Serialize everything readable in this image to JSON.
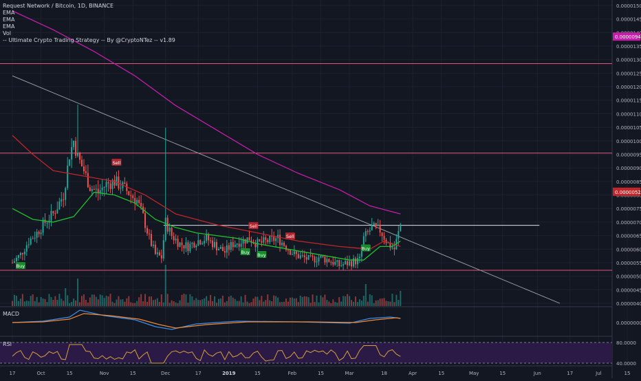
{
  "legend": {
    "title": "Request Network / Bitcoin, 1D, BINANCE",
    "ema1": "EMA",
    "ema2": "EMA",
    "ema3": "EMA",
    "vol": "Vol",
    "strategy": "-- Ultimate Crypto Trading Strategy -- By @CryptoNTez -- v1.89"
  },
  "panes": {
    "macd_label": "MACD",
    "rsi_label": "RSI"
  },
  "colors": {
    "background": "#131722",
    "up": "#26a69a",
    "down": "#ef5350",
    "ema_fast": "#20c030",
    "ema_mid": "#c0262a",
    "ema_slow": "#c41ea8",
    "hline": "#e2557b",
    "trendline": "#9598a1",
    "rsi_band": "#2a1a45",
    "rsi_line": "#d6a23a",
    "macd_line": "#3d8eea",
    "signal_line": "#f08a35"
  },
  "chart_data": {
    "type": "candlestick",
    "price_axis_ticks": [
      "0.00001500",
      "0.00001450",
      "0.00001400",
      "0.00001350",
      "0.00001300",
      "0.00001250",
      "0.00001200",
      "0.00001150",
      "0.00001100",
      "0.00001050",
      "0.00001000",
      "0.00000950",
      "0.00000900",
      "0.00000850",
      "0.00000800",
      "0.00000750",
      "0.00000700",
      "0.00000650",
      "0.00000600",
      "0.00000550",
      "0.00000500",
      "0.00000450",
      "0.00000400"
    ],
    "price_badges": [
      {
        "label": "0.00000949",
        "value": 1.385e-05,
        "color": "#c41ea8"
      },
      {
        "label": "0.00000522",
        "value": 8.12e-06,
        "color": "#c0262a"
      }
    ],
    "y_range": [
      3.9e-06,
      1.52e-05
    ],
    "time_axis": [
      {
        "label": "17",
        "day": 0
      },
      {
        "label": "Oct",
        "day": 14
      },
      {
        "label": "15",
        "day": 28
      },
      {
        "label": "Nov",
        "day": 45
      },
      {
        "label": "15",
        "day": 59
      },
      {
        "label": "Dec",
        "day": 75
      },
      {
        "label": "17",
        "day": 91
      },
      {
        "label": "2019",
        "day": 106
      },
      {
        "label": "15",
        "day": 120
      },
      {
        "label": "Feb",
        "day": 137
      },
      {
        "label": "15",
        "day": 151
      },
      {
        "label": "Mar",
        "day": 165
      },
      {
        "label": "18",
        "day": 182
      },
      {
        "label": "Apr",
        "day": 196
      },
      {
        "label": "15",
        "day": 210
      },
      {
        "label": "May",
        "day": 226
      },
      {
        "label": "15",
        "day": 240
      },
      {
        "label": "Jun",
        "day": 257
      },
      {
        "label": "17",
        "day": 273
      },
      {
        "label": "Jul",
        "day": 287
      },
      {
        "label": "15",
        "day": 301
      }
    ],
    "signals": [
      {
        "label": "Buy",
        "day": 4,
        "kind": "buy"
      },
      {
        "label": "Sell",
        "day": 51,
        "kind": "sell"
      },
      {
        "label": "Sell",
        "day": 118,
        "kind": "sell"
      },
      {
        "label": "Buy",
        "day": 114,
        "kind": "buy"
      },
      {
        "label": "Buy",
        "day": 122,
        "kind": "buy"
      },
      {
        "label": "Sell",
        "day": 136,
        "kind": "sell"
      },
      {
        "label": "Buy",
        "day": 173,
        "kind": "buy"
      }
    ],
    "horizontal_levels": [
      1.285e-05,
      9.55e-06,
      5.22e-06
    ],
    "resistance": {
      "from_day": 74,
      "to_day": 258,
      "value": 6.88e-06
    },
    "trendline": {
      "from": [
        0,
        1.24e-05
      ],
      "to": [
        268,
        4e-06
      ]
    },
    "ema_slow_points": [
      [
        0,
        1.48e-05
      ],
      [
        20,
        1.41e-05
      ],
      [
        40,
        1.33e-05
      ],
      [
        60,
        1.24e-05
      ],
      [
        80,
        1.13e-05
      ],
      [
        100,
        1.04e-05
      ],
      [
        120,
        9.5e-06
      ],
      [
        140,
        8.8e-06
      ],
      [
        160,
        8.2e-06
      ],
      [
        175,
        7.6e-06
      ],
      [
        190,
        7.3e-06
      ]
    ],
    "ema_mid_points": [
      [
        0,
        1.02e-05
      ],
      [
        10,
        9.5e-06
      ],
      [
        20,
        8.9e-06
      ],
      [
        35,
        8.7e-06
      ],
      [
        50,
        8.5e-06
      ],
      [
        65,
        8e-06
      ],
      [
        80,
        7.3e-06
      ],
      [
        100,
        6.9e-06
      ],
      [
        120,
        6.6e-06
      ],
      [
        140,
        6.3e-06
      ],
      [
        160,
        6.1e-06
      ],
      [
        175,
        6e-06
      ],
      [
        182,
        6.3e-06
      ],
      [
        190,
        6.1e-06
      ]
    ],
    "ema_fast_points": [
      [
        0,
        7.5e-06
      ],
      [
        10,
        7.1e-06
      ],
      [
        20,
        7e-06
      ],
      [
        30,
        7.2e-06
      ],
      [
        40,
        8.1e-06
      ],
      [
        50,
        8e-06
      ],
      [
        60,
        7.7e-06
      ],
      [
        70,
        7.1e-06
      ],
      [
        80,
        6.8e-06
      ],
      [
        90,
        6.6e-06
      ],
      [
        100,
        6.5e-06
      ],
      [
        110,
        6.4e-06
      ],
      [
        120,
        6.2e-06
      ],
      [
        135,
        6e-06
      ],
      [
        150,
        5.8e-06
      ],
      [
        165,
        5.6e-06
      ],
      [
        172,
        5.6e-06
      ],
      [
        180,
        6.1e-06
      ],
      [
        186,
        6.1e-06
      ],
      [
        190,
        6.3e-06
      ]
    ],
    "price_path": [
      [
        0,
        5.5e-06
      ],
      [
        4,
        5.8e-06
      ],
      [
        8,
        6.3e-06
      ],
      [
        12,
        6.6e-06
      ],
      [
        16,
        7e-06
      ],
      [
        20,
        7.3e-06
      ],
      [
        25,
        8e-06
      ],
      [
        28,
        9.5e-06
      ],
      [
        30,
        1e-05
      ],
      [
        32,
        9.4e-06
      ],
      [
        35,
        8.9e-06
      ],
      [
        38,
        8.3e-06
      ],
      [
        42,
        8.1e-06
      ],
      [
        46,
        8.4e-06
      ],
      [
        50,
        8.5e-06
      ],
      [
        54,
        8.3e-06
      ],
      [
        58,
        8e-06
      ],
      [
        61,
        7.8e-06
      ],
      [
        64,
        7.2e-06
      ],
      [
        67,
        6.4e-06
      ],
      [
        70,
        5.8e-06
      ],
      [
        73,
        5.7e-06
      ],
      [
        75,
        7e-06
      ],
      [
        78,
        6.5e-06
      ],
      [
        82,
        6.2e-06
      ],
      [
        86,
        6.1e-06
      ],
      [
        90,
        6.3e-06
      ],
      [
        95,
        6.4e-06
      ],
      [
        100,
        6.1e-06
      ],
      [
        104,
        5.9e-06
      ],
      [
        108,
        6.2e-06
      ],
      [
        112,
        6.3e-06
      ],
      [
        116,
        6.4e-06
      ],
      [
        120,
        6.2e-06
      ],
      [
        125,
        6.3e-06
      ],
      [
        130,
        6.4e-06
      ],
      [
        134,
        6.1e-06
      ],
      [
        138,
        5.8e-06
      ],
      [
        142,
        5.7e-06
      ],
      [
        146,
        5.6e-06
      ],
      [
        150,
        5.7e-06
      ],
      [
        155,
        5.6e-06
      ],
      [
        160,
        5.4e-06
      ],
      [
        165,
        5.5e-06
      ],
      [
        170,
        5.6e-06
      ],
      [
        172,
        6.4e-06
      ],
      [
        176,
        6.8e-06
      ],
      [
        180,
        6.7e-06
      ],
      [
        184,
        6.2e-06
      ],
      [
        187,
        6e-06
      ],
      [
        190,
        6.9e-06
      ]
    ],
    "rsi_ticks": [
      "80.0000",
      "40.0000"
    ],
    "macd_ticks": [
      "0.00000000"
    ]
  }
}
